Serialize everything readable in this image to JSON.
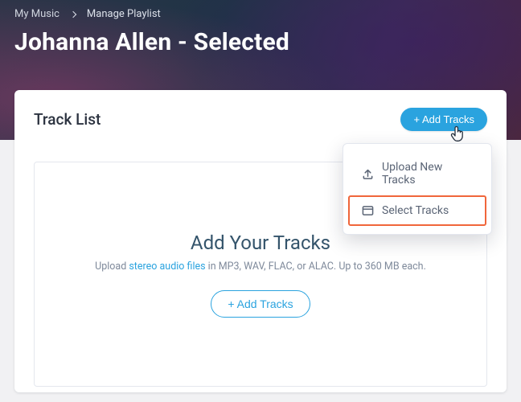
{
  "breadcrumb": {
    "root": "My Music",
    "current": "Manage Playlist"
  },
  "page_title": "Johanna Allen - Selected",
  "section": {
    "title": "Track List"
  },
  "buttons": {
    "add_tracks_primary": "+ Add Tracks",
    "add_tracks_outline": "+ Add Tracks"
  },
  "empty_state": {
    "title": "Add Your Tracks",
    "prefix": "Upload ",
    "link": "stereo audio files",
    "suffix": " in MP3, WAV, FLAC, or ALAC. Up to 360 MB each."
  },
  "menu": {
    "upload": "Upload New Tracks",
    "select": "Select Tracks"
  }
}
